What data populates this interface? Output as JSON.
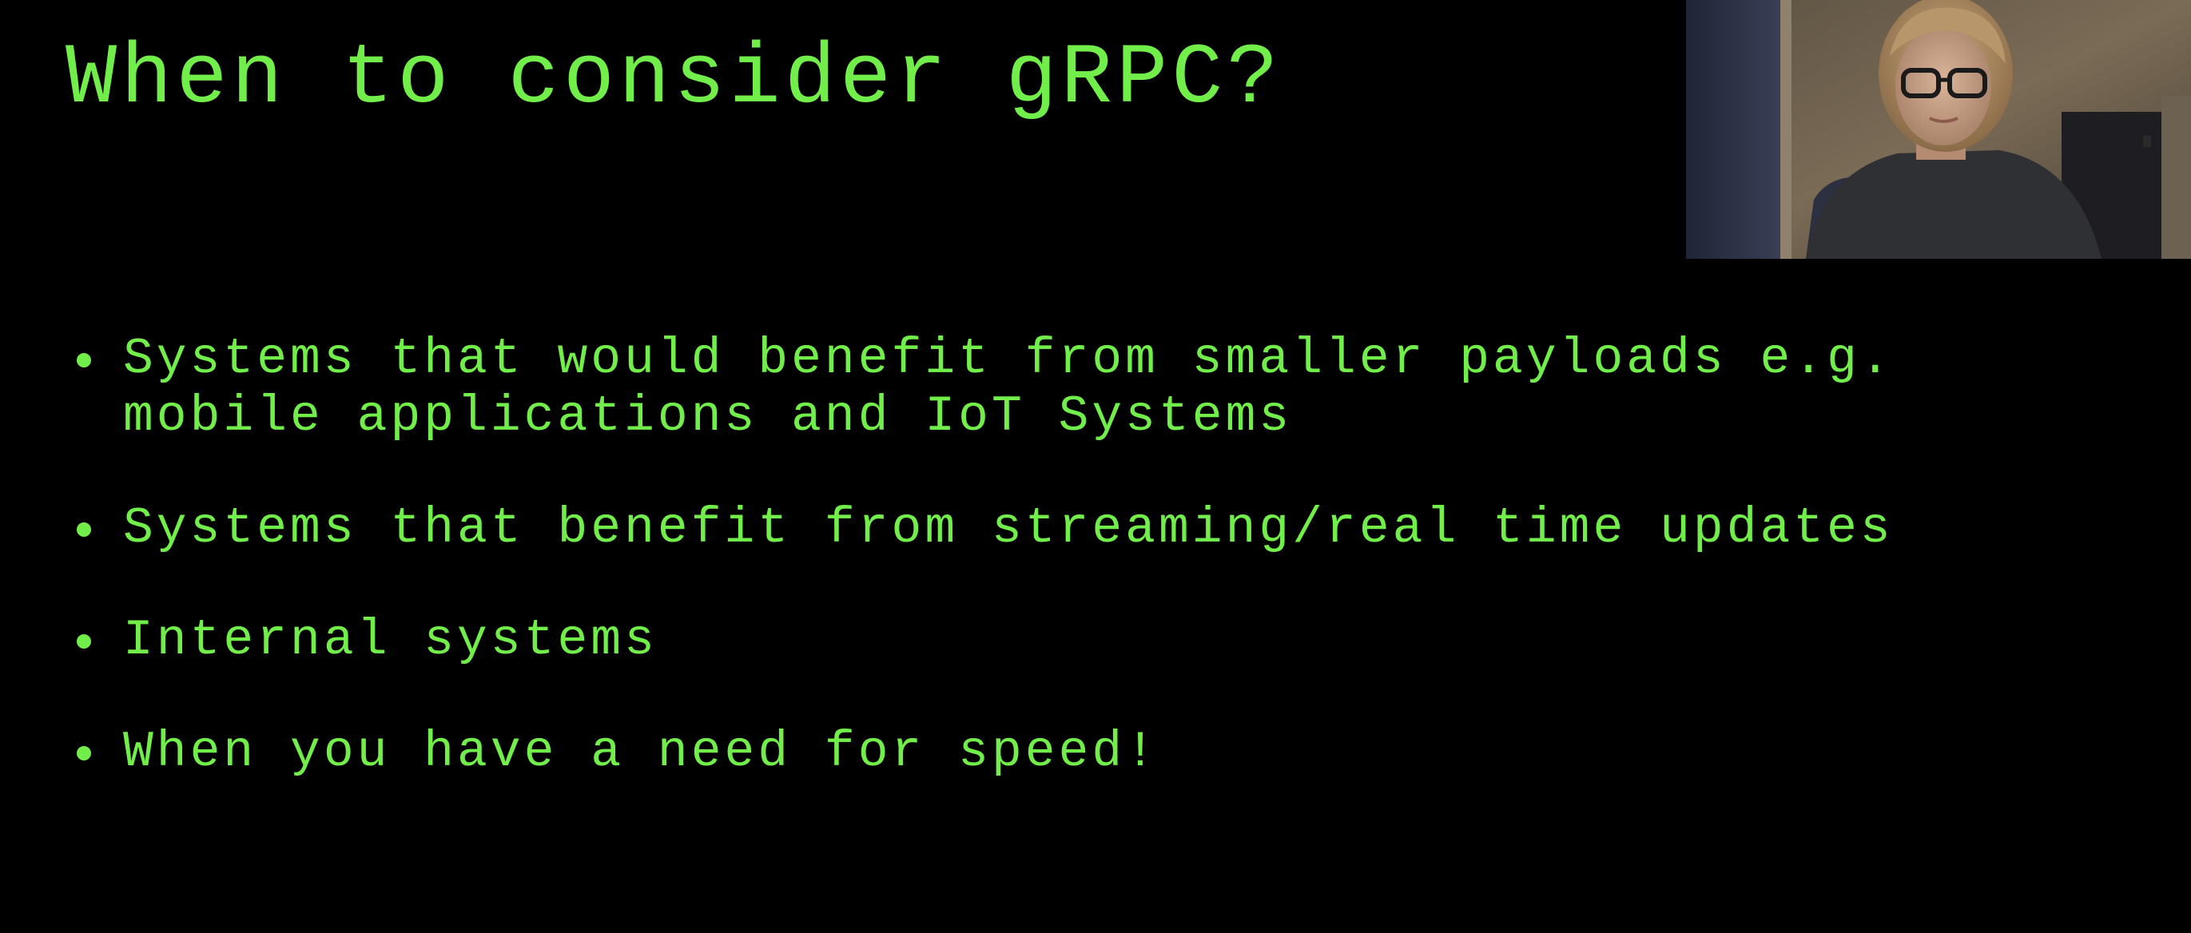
{
  "theme": {
    "background": "#000000",
    "text_color": "#72ee4b"
  },
  "slide": {
    "title": "When to consider gRPC?",
    "bullets": [
      {
        "text": "Systems that would benefit from smaller payloads e.g.\nmobile applications and IoT Systems"
      },
      {
        "text": "Systems that benefit from streaming/real time updates"
      },
      {
        "text": "Internal systems"
      },
      {
        "text": "When you have a need for speed!"
      }
    ]
  },
  "webcam": {
    "icon": "presenter-video-feed"
  }
}
